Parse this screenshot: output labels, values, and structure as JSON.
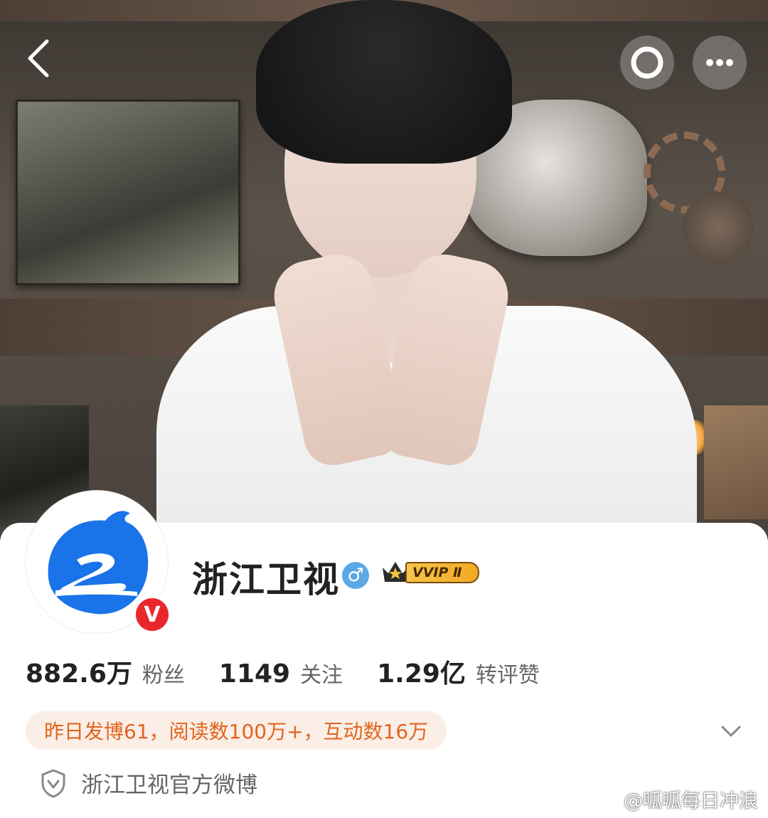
{
  "profile": {
    "name": "浙江卫视",
    "gender_icon": "male-icon",
    "verified_badge": "V",
    "vip_badge": "VVIP Ⅱ",
    "description": "浙江卫视官方微博"
  },
  "stats": [
    {
      "value": "882.6",
      "unit": "万",
      "label": "粉丝"
    },
    {
      "value": "1149",
      "unit": "",
      "label": "关注"
    },
    {
      "value": "1.29",
      "unit": "亿",
      "label": "转评赞"
    }
  ],
  "activity": {
    "text": "昨日发博61，阅读数100万+，互动数16万"
  },
  "topbar": {
    "back_icon": "back-icon",
    "circle_icon": "circle-icon",
    "more_icon": "more-icon"
  },
  "watermark": {
    "text": "@呱呱每日冲浪"
  },
  "colors": {
    "accent_orange": "#e0651d",
    "verified_red": "#e8272a",
    "gender_blue": "#5aa8e6",
    "avatar_blue": "#1a73e8"
  }
}
